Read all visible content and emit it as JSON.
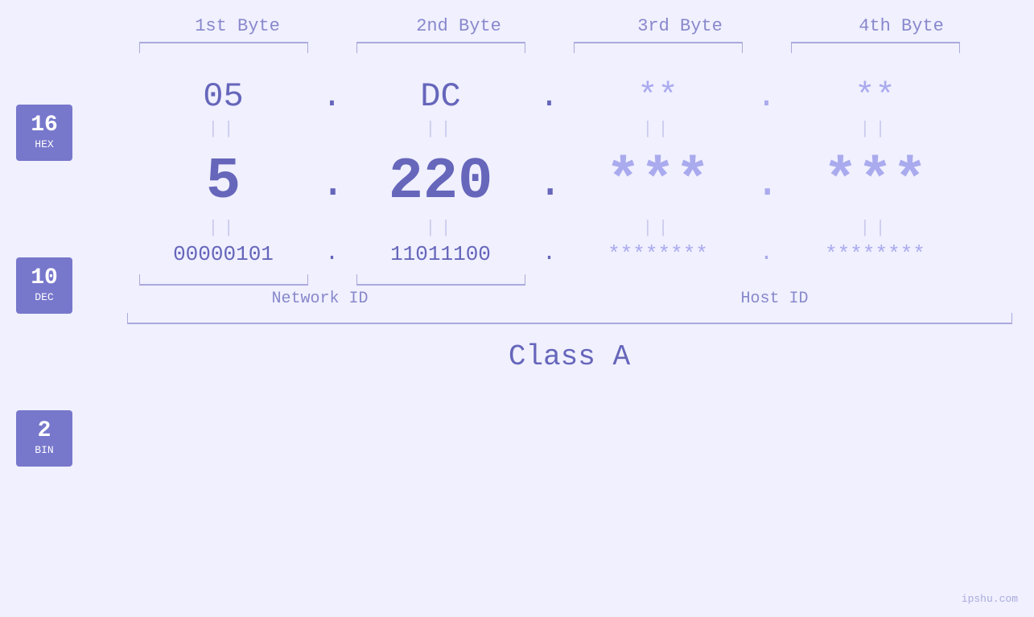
{
  "header": {
    "byte1": "1st Byte",
    "byte2": "2nd Byte",
    "byte3": "3rd Byte",
    "byte4": "4th Byte"
  },
  "bases": [
    {
      "num": "16",
      "name": "HEX"
    },
    {
      "num": "10",
      "name": "DEC"
    },
    {
      "num": "2",
      "name": "BIN"
    }
  ],
  "hex": {
    "b1": "05",
    "b2": "DC",
    "b3": "**",
    "b4": "**"
  },
  "dec": {
    "b1": "5",
    "b2": "220",
    "b3": "***",
    "b4": "***"
  },
  "bin": {
    "b1": "00000101",
    "b2": "11011100",
    "b3": "********",
    "b4": "********"
  },
  "labels": {
    "network_id": "Network ID",
    "host_id": "Host ID",
    "class": "Class A"
  },
  "watermark": "ipshu.com"
}
